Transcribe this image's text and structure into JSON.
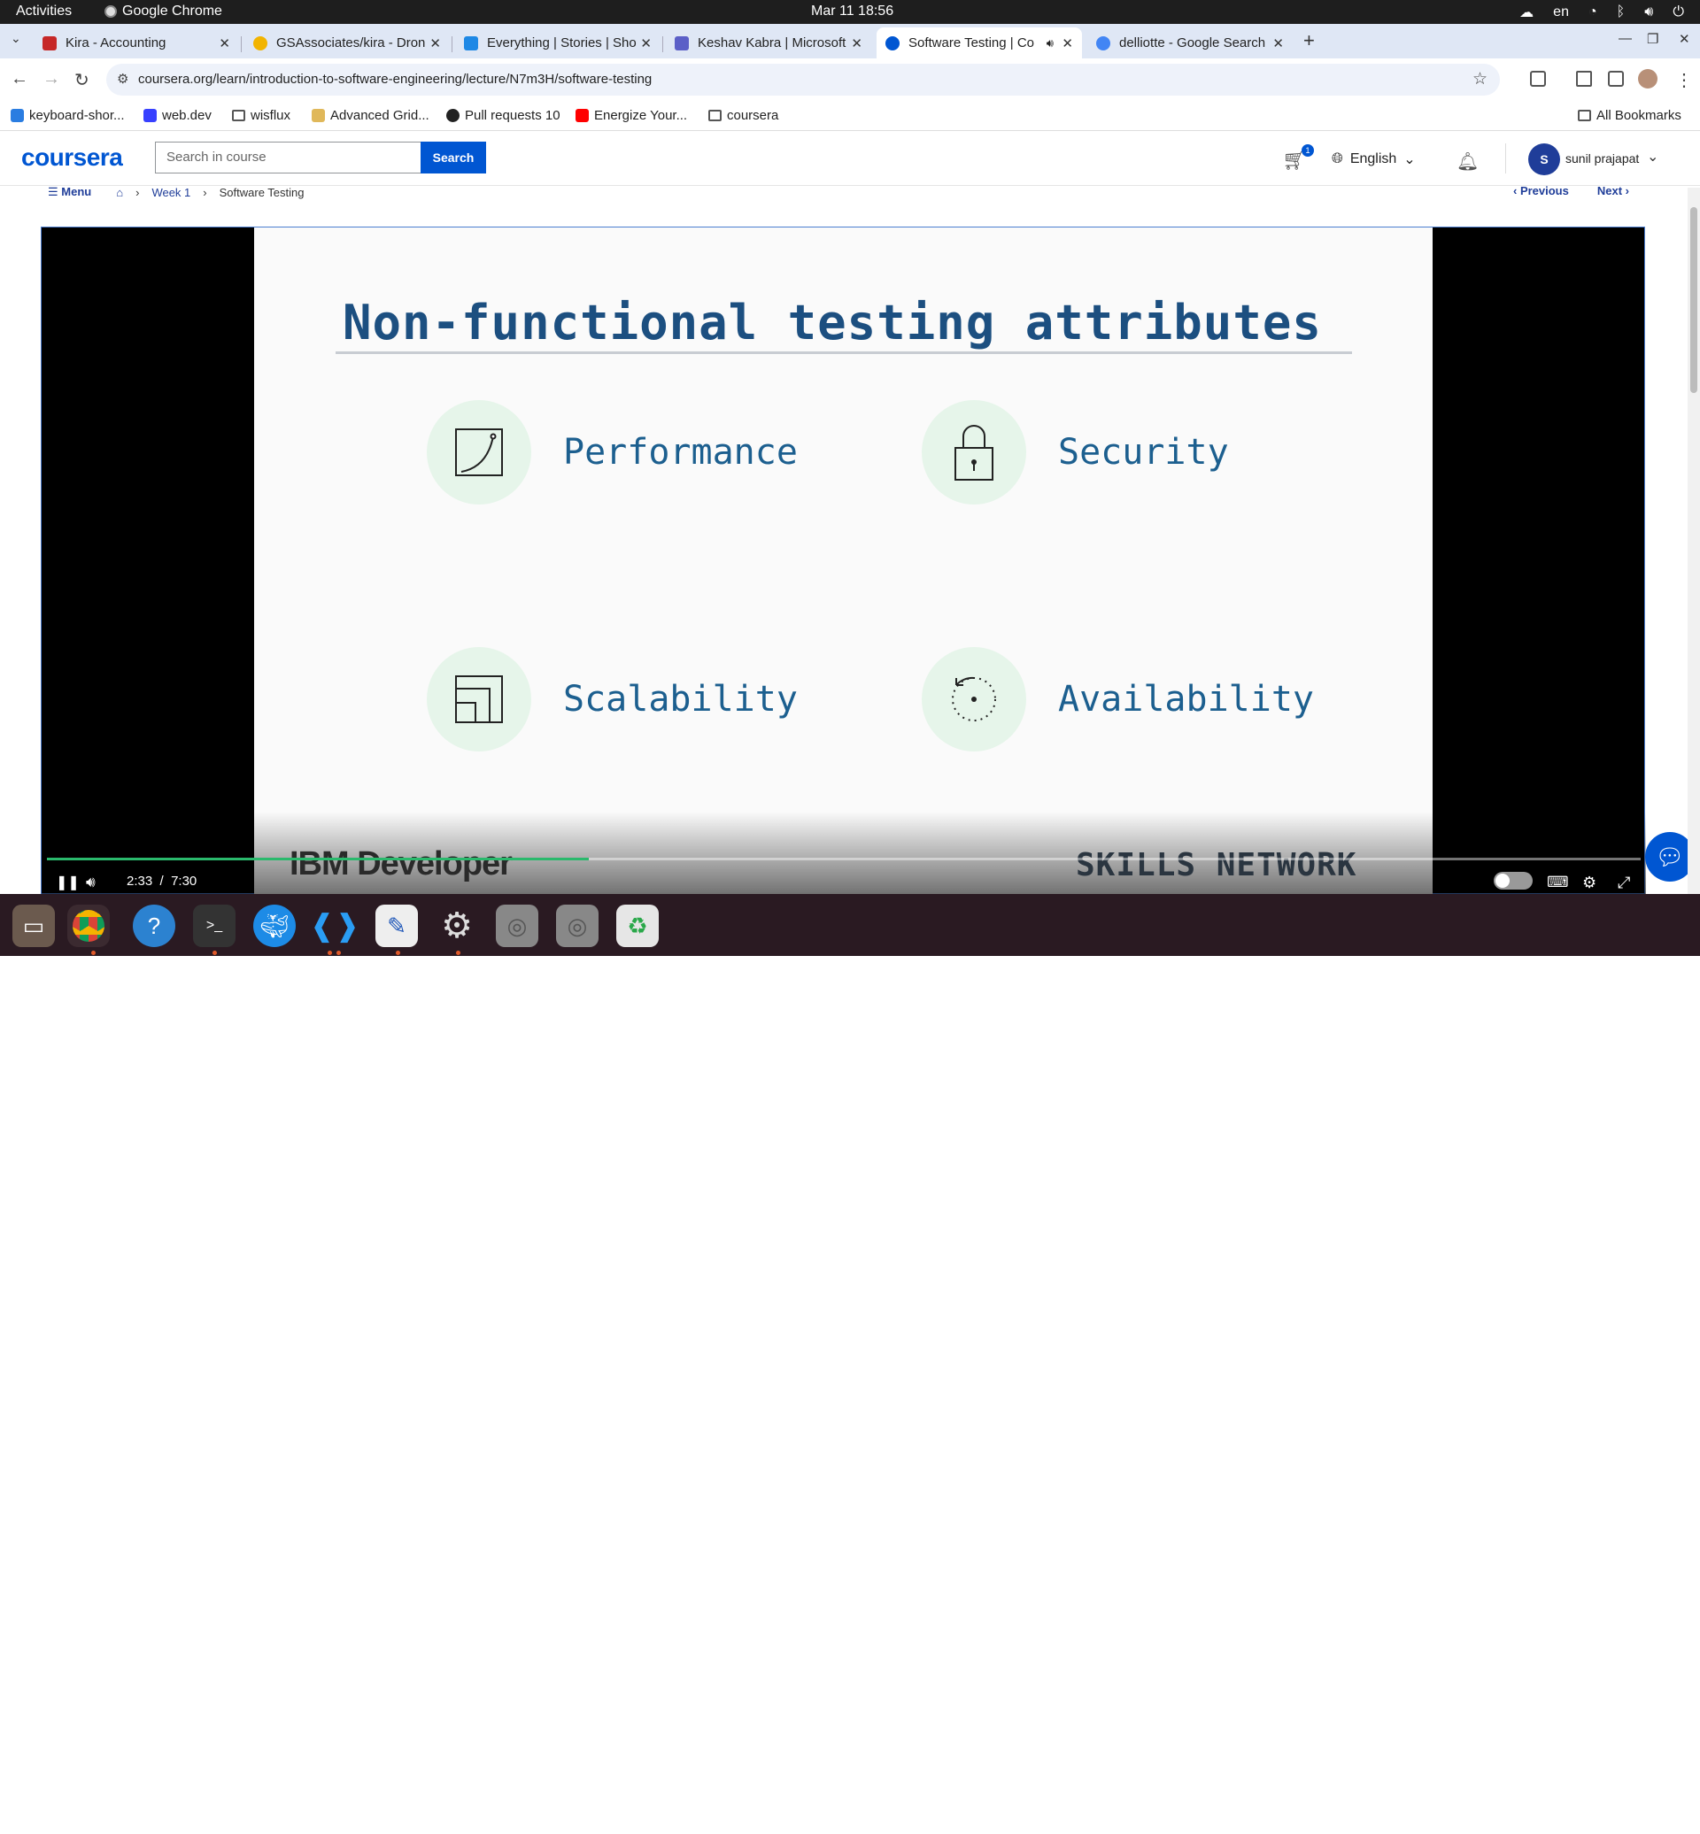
{
  "system_bar": {
    "activities": "Activities",
    "app_name": "Google Chrome",
    "clock": "Mar 11  18:56",
    "lang": "en"
  },
  "tabs": [
    {
      "title": "Kira - Accounting",
      "color": "#c62828"
    },
    {
      "title": "GSAssociates/kira - Dron",
      "color": "#f2b400"
    },
    {
      "title": "Everything | Stories | Sho",
      "color": "#1e88e5"
    },
    {
      "title": "Keshav Kabra | Microsoft",
      "color": "#5b5fc7"
    },
    {
      "title": "Software Testing | Co",
      "color": "#0056d2"
    },
    {
      "title": "delliotte - Google Search",
      "color": "#4285f4"
    }
  ],
  "address_bar": {
    "url": "coursera.org/learn/introduction-to-software-engineering/lecture/N7m3H/software-testing"
  },
  "bookmarks": {
    "items": [
      "keyboard-shor...",
      "web.dev",
      "wisflux",
      "Advanced Grid...",
      "Pull requests 10",
      "Energize Your...",
      "coursera"
    ],
    "all": "All Bookmarks"
  },
  "coursera": {
    "logo": "coursera",
    "search_placeholder": "Search in course",
    "search_button": "Search",
    "cart_count": "1",
    "language": "English",
    "user_initial": "S",
    "user_name": "sunil prajapat",
    "accent": "#0056d2"
  },
  "breadcrumb": {
    "menu": "Menu",
    "week": "Week 1",
    "current": "Software Testing",
    "previous": "Previous",
    "next": "Next"
  },
  "slide": {
    "title": "Non-functional testing attributes",
    "attributes": [
      {
        "label": "Performance",
        "icon": "performance-graph-icon"
      },
      {
        "label": "Security",
        "icon": "padlock-icon"
      },
      {
        "label": "Scalability",
        "icon": "scalability-squares-icon"
      },
      {
        "label": "Availability",
        "icon": "availability-dial-icon"
      }
    ],
    "footer_left": "IBM Developer",
    "footer_right": "SKILLS NETWORK"
  },
  "player": {
    "current_time": "2:33",
    "separator": "/",
    "duration": "7:30",
    "progress_fraction": 0.34
  },
  "dock_apps": [
    "files-icon",
    "chrome-icon",
    "help-icon",
    "terminal-icon",
    "docker-icon",
    "vscode-icon",
    "text-editor-icon",
    "settings-icon",
    "disk-icon",
    "disk-icon",
    "trash-icon"
  ]
}
